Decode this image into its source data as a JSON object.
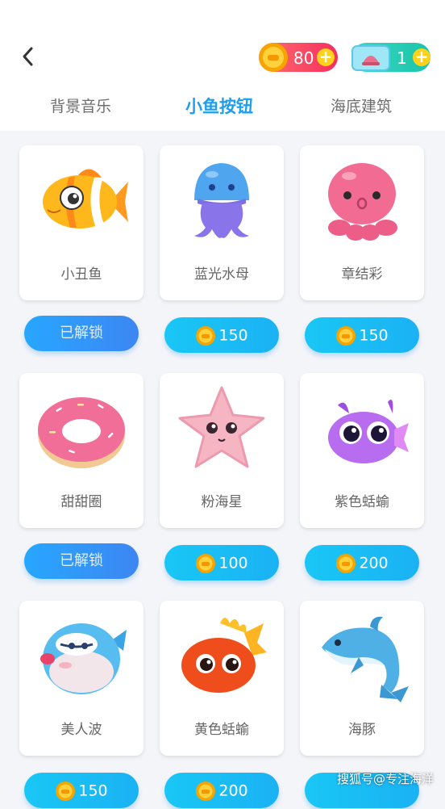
{
  "header": {
    "coins": "80",
    "tickets": "1"
  },
  "tabs": [
    {
      "label": "背景音乐"
    },
    {
      "label": "小鱼按钮"
    },
    {
      "label": "海底建筑"
    }
  ],
  "items": [
    {
      "name": "小丑鱼",
      "button": "已解锁"
    },
    {
      "name": "蓝光水母",
      "button": "150"
    },
    {
      "name": "章结彩",
      "button": "150"
    },
    {
      "name": "甜甜圈",
      "button": "已解锁"
    },
    {
      "name": "粉海星",
      "button": "100"
    },
    {
      "name": "紫色蛞蝓",
      "button": "200"
    },
    {
      "name": "美人波",
      "button": "150"
    },
    {
      "name": "黄色蛞蝓",
      "button": "200"
    },
    {
      "name": "海豚",
      "button": ""
    }
  ],
  "watermark": "搜狐号@专注海洋"
}
